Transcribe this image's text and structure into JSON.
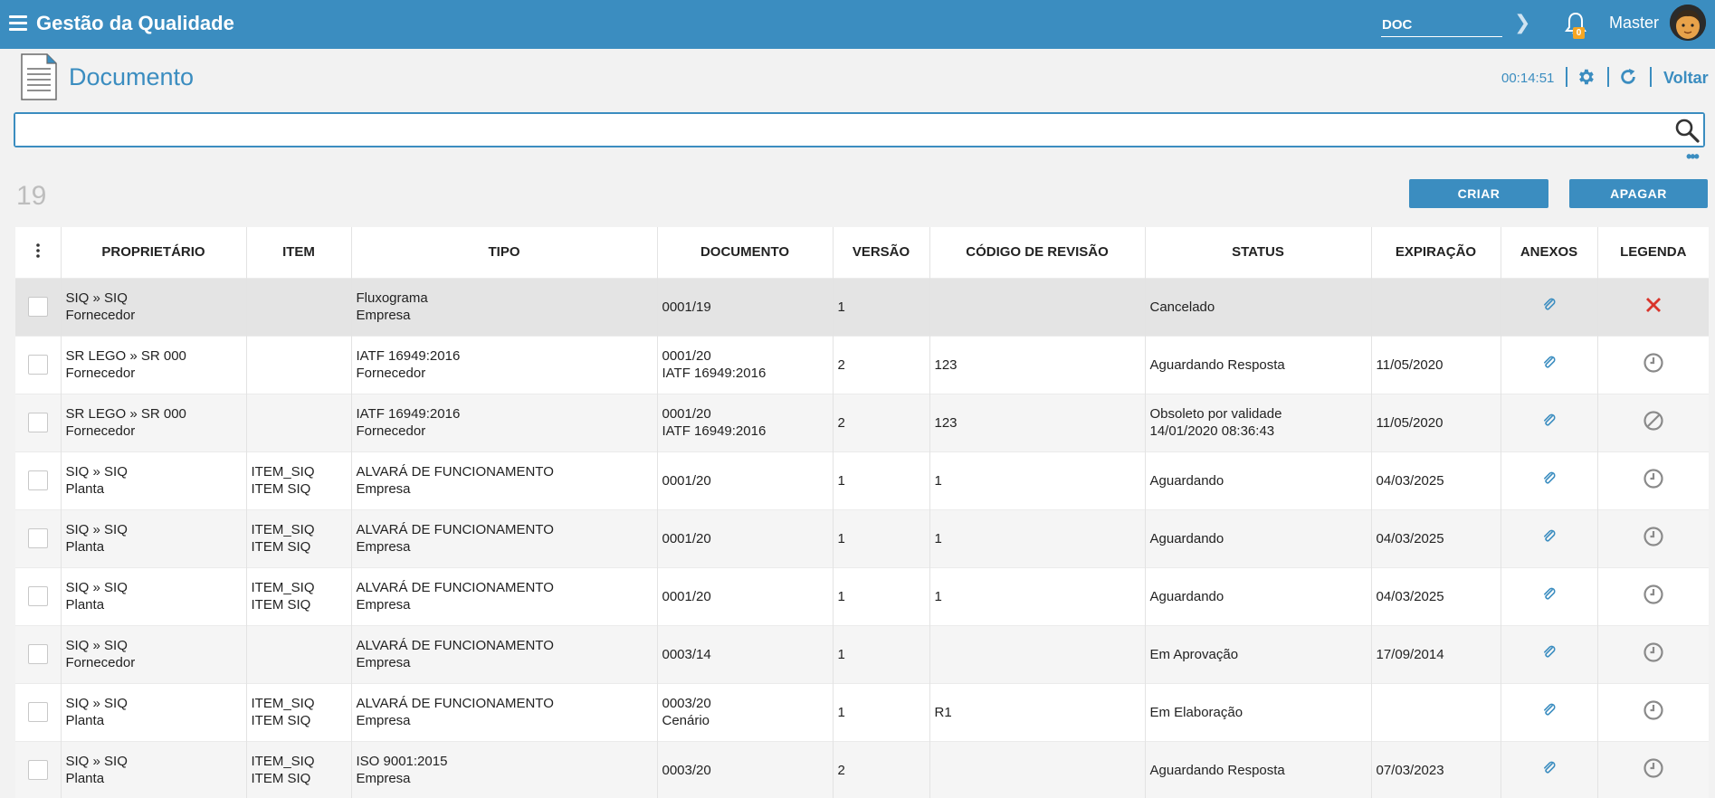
{
  "app": {
    "title": "Gestão da Qualidade"
  },
  "topbar": {
    "doc_input_value": "DOC",
    "notification_count": "0",
    "user_name": "Master"
  },
  "page": {
    "title": "Documento",
    "timer": "00:14:51",
    "back_label": "Voltar"
  },
  "search": {
    "value": "",
    "placeholder": ""
  },
  "summary": {
    "count": "19"
  },
  "actions": {
    "create_label": "CRIAR",
    "delete_label": "APAGAR"
  },
  "table": {
    "columns": [
      "PROPRIETÁRIO",
      "ITEM",
      "TIPO",
      "DOCUMENTO",
      "VERSÃO",
      "CÓDIGO DE REVISÃO",
      "STATUS",
      "EXPIRAÇÃO",
      "ANEXOS",
      "LEGENDA"
    ],
    "rows": [
      {
        "owner1": "SIQ » SIQ",
        "owner2": "Fornecedor",
        "item1": "",
        "item2": "",
        "type1": "Fluxograma",
        "type2": "Empresa",
        "doc1": "0001/19",
        "doc2": "",
        "version": "1",
        "revision": "",
        "status1": "Cancelado",
        "status2": "",
        "expiration": "",
        "legend": "cancelled-icon"
      },
      {
        "owner1": "SR LEGO » SR 000",
        "owner2": "Fornecedor",
        "item1": "",
        "item2": "",
        "type1": "IATF 16949:2016",
        "type2": "Fornecedor",
        "doc1": "0001/20",
        "doc2": "IATF 16949:2016",
        "version": "2",
        "revision": "123",
        "status1": "Aguardando Resposta",
        "status2": "",
        "expiration": "11/05/2020",
        "legend": "clock-icon"
      },
      {
        "owner1": "SR LEGO » SR 000",
        "owner2": "Fornecedor",
        "item1": "",
        "item2": "",
        "type1": "IATF 16949:2016",
        "type2": "Fornecedor",
        "doc1": "0001/20",
        "doc2": "IATF 16949:2016",
        "version": "2",
        "revision": "123",
        "status1": "Obsoleto por validade",
        "status2": "14/01/2020 08:36:43",
        "expiration": "11/05/2020",
        "legend": "obsolete-icon"
      },
      {
        "owner1": "SIQ » SIQ",
        "owner2": "Planta",
        "item1": "ITEM_SIQ",
        "item2": "ITEM SIQ",
        "type1": "ALVARÁ DE FUNCIONAMENTO",
        "type2": "Empresa",
        "doc1": "0001/20",
        "doc2": "",
        "version": "1",
        "revision": "1",
        "status1": "Aguardando",
        "status2": "",
        "expiration": "04/03/2025",
        "legend": "clock-icon"
      },
      {
        "owner1": "SIQ » SIQ",
        "owner2": "Planta",
        "item1": "ITEM_SIQ",
        "item2": "ITEM SIQ",
        "type1": "ALVARÁ DE FUNCIONAMENTO",
        "type2": "Empresa",
        "doc1": "0001/20",
        "doc2": "",
        "version": "1",
        "revision": "1",
        "status1": "Aguardando",
        "status2": "",
        "expiration": "04/03/2025",
        "legend": "clock-icon"
      },
      {
        "owner1": "SIQ » SIQ",
        "owner2": "Planta",
        "item1": "ITEM_SIQ",
        "item2": "ITEM SIQ",
        "type1": "ALVARÁ DE FUNCIONAMENTO",
        "type2": "Empresa",
        "doc1": "0001/20",
        "doc2": "",
        "version": "1",
        "revision": "1",
        "status1": "Aguardando",
        "status2": "",
        "expiration": "04/03/2025",
        "legend": "clock-icon"
      },
      {
        "owner1": "SIQ » SIQ",
        "owner2": "Fornecedor",
        "item1": "",
        "item2": "",
        "type1": "ALVARÁ DE FUNCIONAMENTO",
        "type2": "Empresa",
        "doc1": "0003/14",
        "doc2": "",
        "version": "1",
        "revision": "",
        "status1": "Em Aprovação",
        "status2": "",
        "expiration": "17/09/2014",
        "legend": "clock-icon"
      },
      {
        "owner1": "SIQ » SIQ",
        "owner2": "Planta",
        "item1": "ITEM_SIQ",
        "item2": "ITEM SIQ",
        "type1": "ALVARÁ DE FUNCIONAMENTO",
        "type2": "Empresa",
        "doc1": "0003/20",
        "doc2": "Cenário",
        "version": "1",
        "revision": "R1",
        "status1": "Em Elaboração",
        "status2": "",
        "expiration": "",
        "legend": "clock-icon"
      },
      {
        "owner1": "SIQ » SIQ",
        "owner2": "Planta",
        "item1": "ITEM_SIQ",
        "item2": "ITEM SIQ",
        "type1": "ISO 9001:2015",
        "type2": "Empresa",
        "doc1": "0003/20",
        "doc2": "",
        "version": "2",
        "revision": "",
        "status1": "Aguardando Resposta",
        "status2": "",
        "expiration": "07/03/2023",
        "legend": "clock-icon"
      }
    ]
  },
  "colors": {
    "primary": "#3b8dc0",
    "cancel": "#d9342b",
    "legend_gray": "#8a8a8a",
    "badge": "#f6a623"
  }
}
